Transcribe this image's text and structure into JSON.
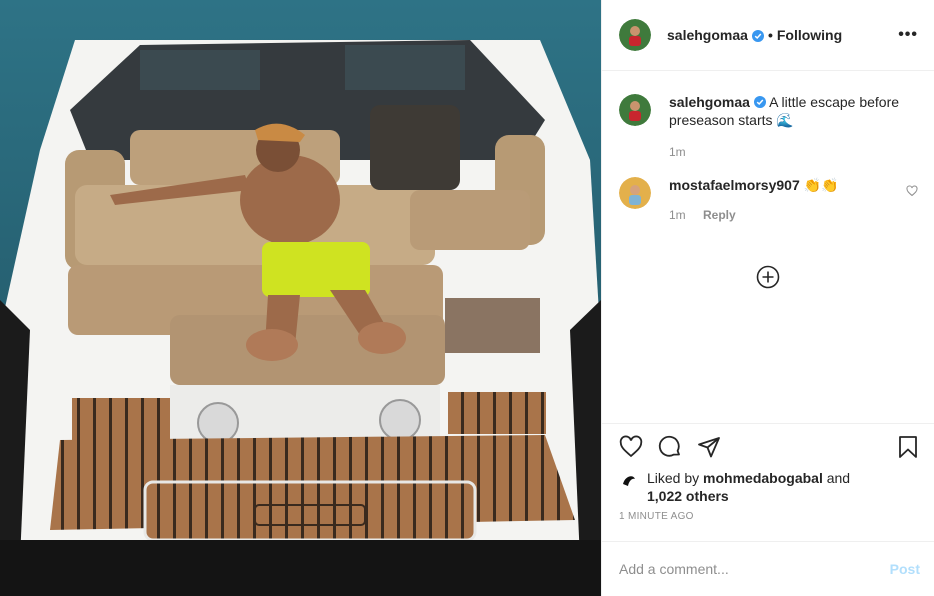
{
  "header": {
    "username": "salehgomaa",
    "separator": "•",
    "follow_status": "Following",
    "more_label": "•••"
  },
  "caption": {
    "username": "salehgomaa",
    "text": "A little escape before preseason starts 🌊",
    "time": "1m"
  },
  "comments": [
    {
      "username": "mostafaelmorsy907",
      "text": "👏👏",
      "time": "1m",
      "reply_label": "Reply"
    }
  ],
  "likes": {
    "prefix": "Liked by",
    "user": "mohmedabogabal",
    "and": "and",
    "others": "1,022 others"
  },
  "timestamp": "1 MINUTE AGO",
  "add_comment": {
    "placeholder": "Add a comment...",
    "post_label": "Post"
  },
  "icons": {
    "like": "heart-icon",
    "comment": "comment-icon",
    "share": "share-icon",
    "save": "bookmark-icon",
    "verified": "verified-badge-icon",
    "load_more": "plus-circle-icon"
  },
  "colors": {
    "verified": "#3897f0",
    "post_disabled": "#b2dffc",
    "secondary_text": "#8e8e8e",
    "divider": "#efefef"
  }
}
